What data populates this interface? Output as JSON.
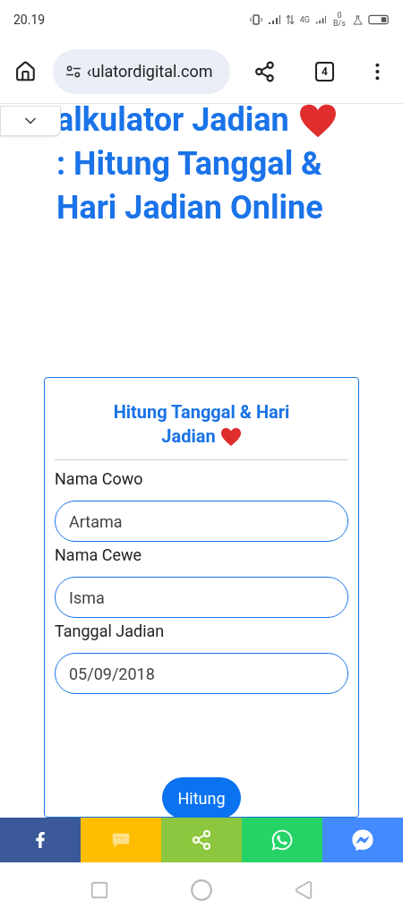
{
  "status_bar": {
    "time": "20.19",
    "network_type": "4G",
    "data_speed": "0 B/s"
  },
  "browser": {
    "url": "‹ulatordigital.com",
    "tab_count": "4"
  },
  "page": {
    "title_line_1": "alkulator Jadian",
    "title_rest": ": Hitung Tanggal & Hari Jadian Online"
  },
  "form": {
    "heading": "Hitung Tanggal & Hari Jadian",
    "fields": [
      {
        "label": "Nama Cowo",
        "value": "Artama"
      },
      {
        "label": "Nama Cewe",
        "value": "Isma"
      },
      {
        "label": "Tanggal Jadian",
        "value": "05/09/2018"
      }
    ],
    "submit": "Hitung"
  },
  "share_bar": [
    {
      "kind": "facebook",
      "color": "#3b5998"
    },
    {
      "kind": "sms",
      "color": "#ffbd00"
    },
    {
      "kind": "share",
      "color": "#8dc63f"
    },
    {
      "kind": "whatsapp",
      "color": "#25d366"
    },
    {
      "kind": "messenger",
      "color": "#448aff"
    }
  ]
}
